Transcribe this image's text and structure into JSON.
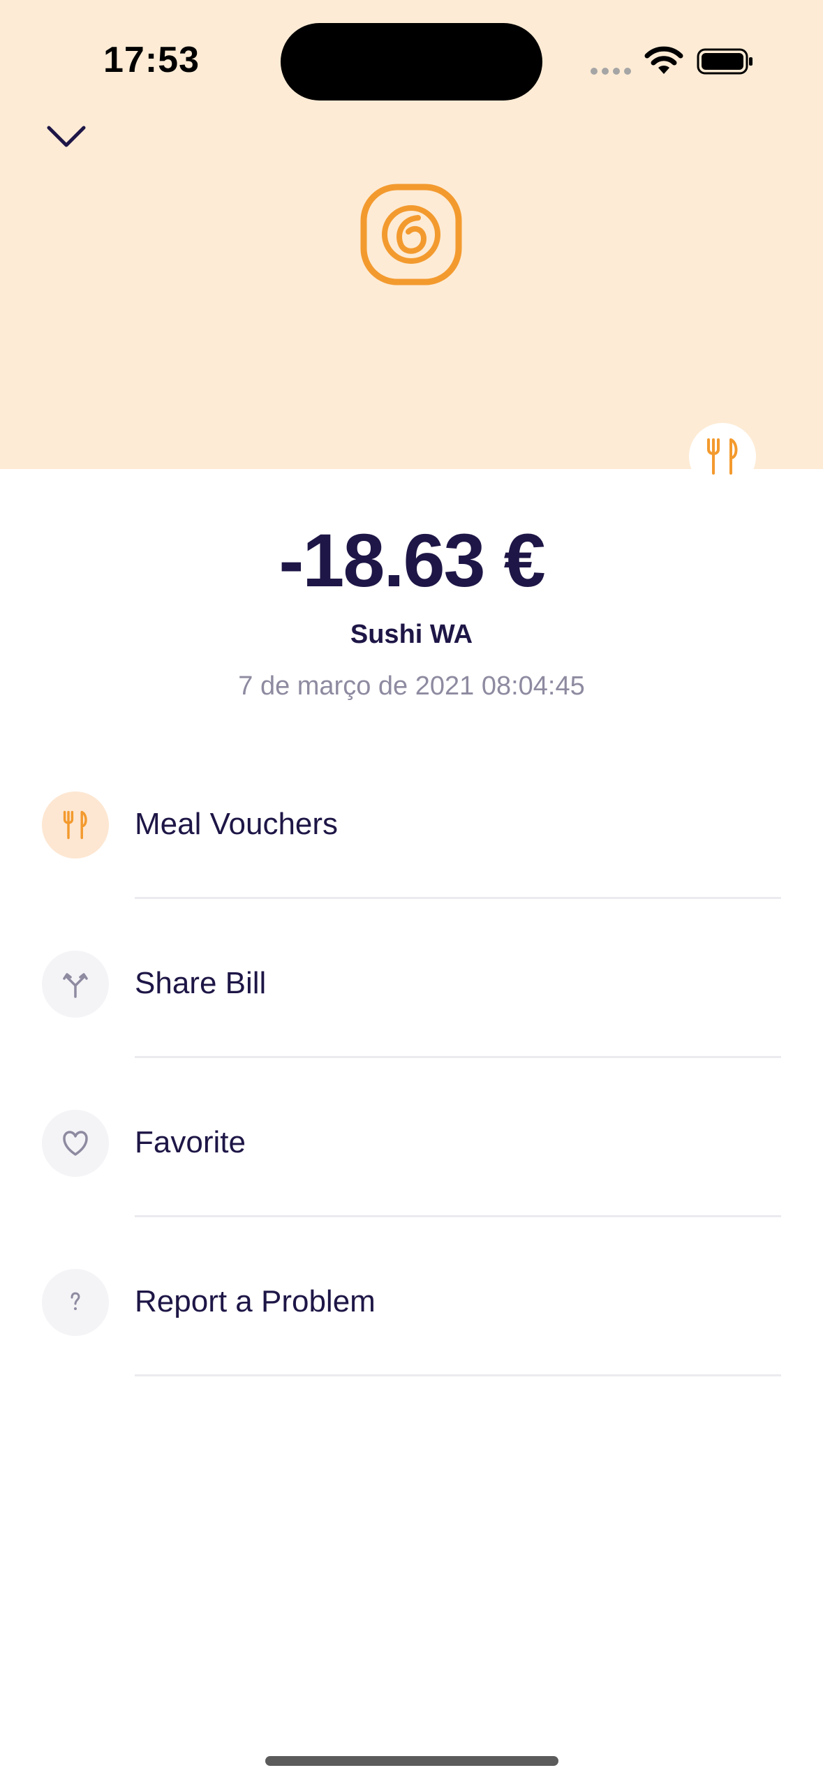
{
  "status_bar": {
    "time": "17:53",
    "icons": [
      "signal-dots-icon",
      "wifi-icon",
      "battery-icon"
    ]
  },
  "header": {
    "background_color": "#fdebd5",
    "back_icon": "chevron-down-icon",
    "merchant_logo_icon": "sushi-logo-icon",
    "category_icon": "fork-knife-icon",
    "accent_color": "#f39a2e"
  },
  "transaction": {
    "amount": "-18.63 €",
    "merchant": "Sushi WA",
    "date": "7 de março de 2021 08:04:45"
  },
  "actions": [
    {
      "label": "Meal Vouchers",
      "icon": "fork-knife-icon"
    },
    {
      "label": "Share Bill",
      "icon": "split-arrows-icon"
    },
    {
      "label": "Favorite",
      "icon": "heart-icon"
    },
    {
      "label": "Report a Problem",
      "icon": "question-mark-icon"
    }
  ]
}
